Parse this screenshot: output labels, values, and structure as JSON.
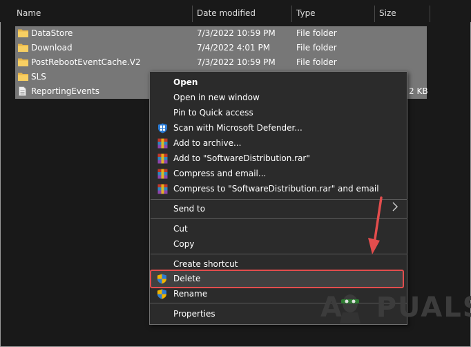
{
  "columns": {
    "name": "Name",
    "date_modified": "Date modified",
    "type": "Type",
    "size": "Size"
  },
  "files": [
    {
      "name": "DataStore",
      "date": "7/3/2022 10:59 PM",
      "type": "File folder",
      "size": "",
      "kind": "folder",
      "selected": true
    },
    {
      "name": "Download",
      "date": "7/4/2022 4:01 PM",
      "type": "File folder",
      "size": "",
      "kind": "folder",
      "selected": true
    },
    {
      "name": "PostRebootEventCache.V2",
      "date": "7/3/2022 10:59 PM",
      "type": "File folder",
      "size": "",
      "kind": "folder",
      "selected": true
    },
    {
      "name": "SLS",
      "date": "",
      "type": "",
      "size": "",
      "kind": "folder",
      "selected": true
    },
    {
      "name": "ReportingEvents",
      "date": "",
      "type": "",
      "size": "2 KB",
      "kind": "file",
      "selected": true
    }
  ],
  "context_menu": {
    "open": "Open",
    "open_new_window": "Open in new window",
    "pin_quick_access": "Pin to Quick access",
    "scan_defender": "Scan with Microsoft Defender...",
    "add_archive": "Add to archive...",
    "add_rar": "Add to \"SoftwareDistribution.rar\"",
    "compress_email": "Compress and email...",
    "compress_rar_email": "Compress to \"SoftwareDistribution.rar\" and email",
    "send_to": "Send to",
    "cut": "Cut",
    "copy": "Copy",
    "create_shortcut": "Create shortcut",
    "delete": "Delete",
    "rename": "Rename",
    "properties": "Properties"
  },
  "colors": {
    "highlight_border": "#e34d4d",
    "arrow": "#e34d4d",
    "selection": "#777777",
    "menu_bg": "#2b2b2b"
  },
  "icons": {
    "folder": "folder-icon",
    "file": "file-icon",
    "defender": "shield-icon",
    "winrar": "winrar-icon",
    "uac": "uac-shield-icon"
  }
}
